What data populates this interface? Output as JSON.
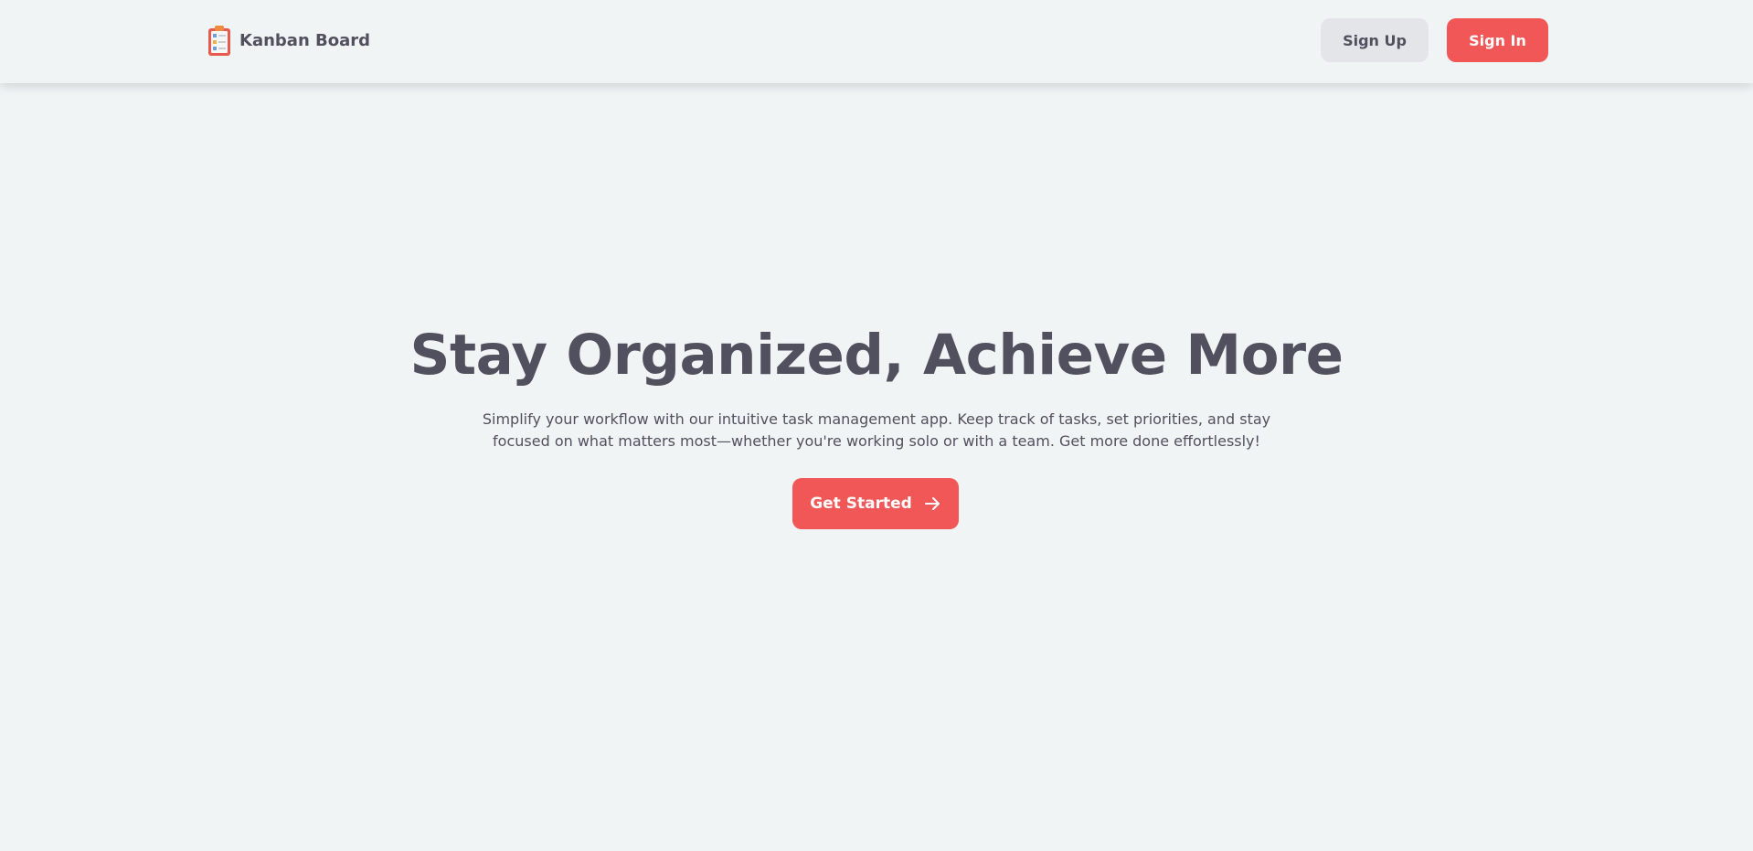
{
  "header": {
    "brand": {
      "name": "Kanban Board",
      "icon": "clipboard-icon"
    },
    "sign_up_label": "Sign Up",
    "sign_in_label": "Sign In"
  },
  "hero": {
    "title": "Stay Organized, Achieve More",
    "subtitle": "Simplify your workflow with our intuitive task management app. Keep track of tasks, set priorities, and stay focused on what matters most—whether you're working solo or with a team. Get more done effortlessly!",
    "cta_label": "Get Started",
    "cta_icon": "arrow-right-icon"
  },
  "colors": {
    "background": "#f0f4f5",
    "accent": "#f25757",
    "text": "#50505e",
    "secondary_button": "#e4e5e9"
  }
}
